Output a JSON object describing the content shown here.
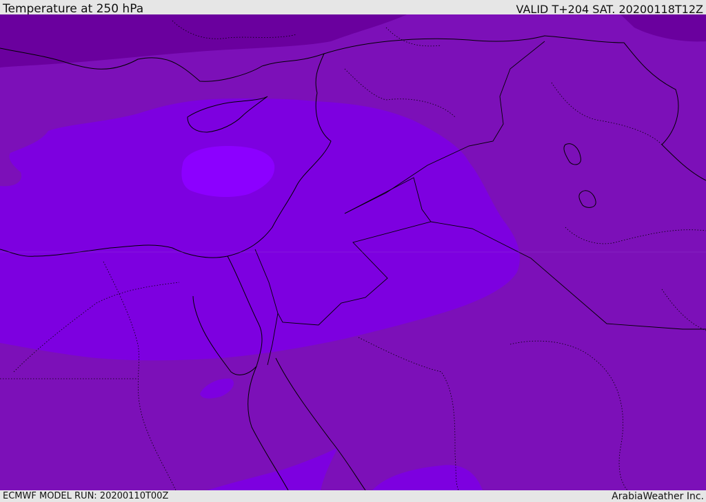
{
  "header": {
    "title": "Temperature at 250 hPa",
    "valid": "VALID T+204 SAT. 20200118T12Z"
  },
  "footer": {
    "model_run": "ECMWF MODEL RUN: 20200110T00Z",
    "credit": "ArabiaWeather Inc."
  },
  "map": {
    "variable": "temperature",
    "level": "250 hPa",
    "region": "Eastern Mediterranean / Middle East",
    "colors": {
      "coldest_band": "#6a009e",
      "background_band": "#7c10b8",
      "mid_band": "#7d00e0",
      "warmest_band": "#8c00ff",
      "borders": "#000000"
    }
  }
}
